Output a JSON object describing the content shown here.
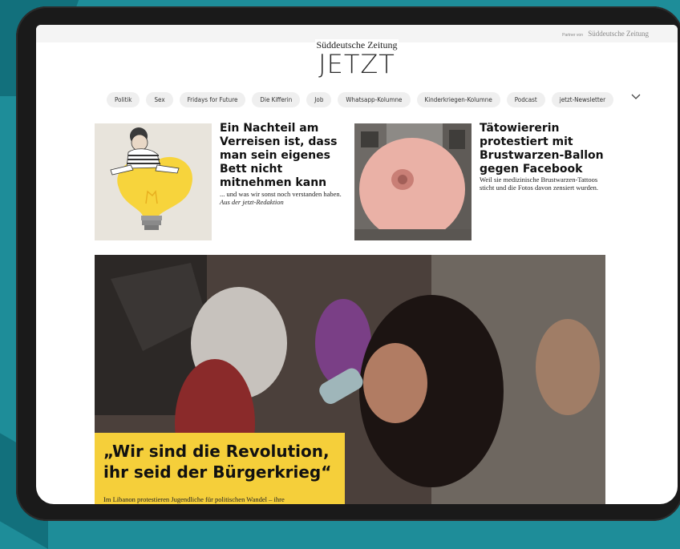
{
  "header": {
    "partner_prefix": "Partner von",
    "partner_name": "Süddeutsche Zeitung",
    "logo": "Süddeutsche Zeitung",
    "title": "JETZT"
  },
  "nav": {
    "items": [
      "Politik",
      "Sex",
      "Fridays for Future",
      "Die Kifferin",
      "Job",
      "Whatsapp-Kolumne",
      "Kinderkriegen-Kolumne",
      "Podcast",
      "jetzt-Newsletter"
    ],
    "more_icon": "chevron-down-icon"
  },
  "teasers": [
    {
      "image": "lightbulb-illustration",
      "title": "Ein Nachteil am Verreisen ist, dass man sein eigenes Bett nicht mitnehmen kann",
      "text": "... und was wir sonst noch verstanden haben.",
      "byline": "Aus der jetzt-Redaktion"
    },
    {
      "image": "balloon-photo",
      "title": "Tätowiererin protestiert mit Brustwarzen-Ballon gegen Facebook",
      "text": "Weil sie medizinische Brustwarzen-Tattoos sticht und die Fotos davon zensiert wurden."
    }
  ],
  "hero": {
    "image": "protest-photo",
    "title": "„Wir sind die Revolution, ihr seid der Bürgerkrieg“",
    "text": "Im Libanon protestieren Jugendliche für politischen Wandel – ihre"
  },
  "colors": {
    "background": "#1e8d99",
    "hero_box": "#f5cf3a",
    "bulb": "#f7d43c"
  }
}
